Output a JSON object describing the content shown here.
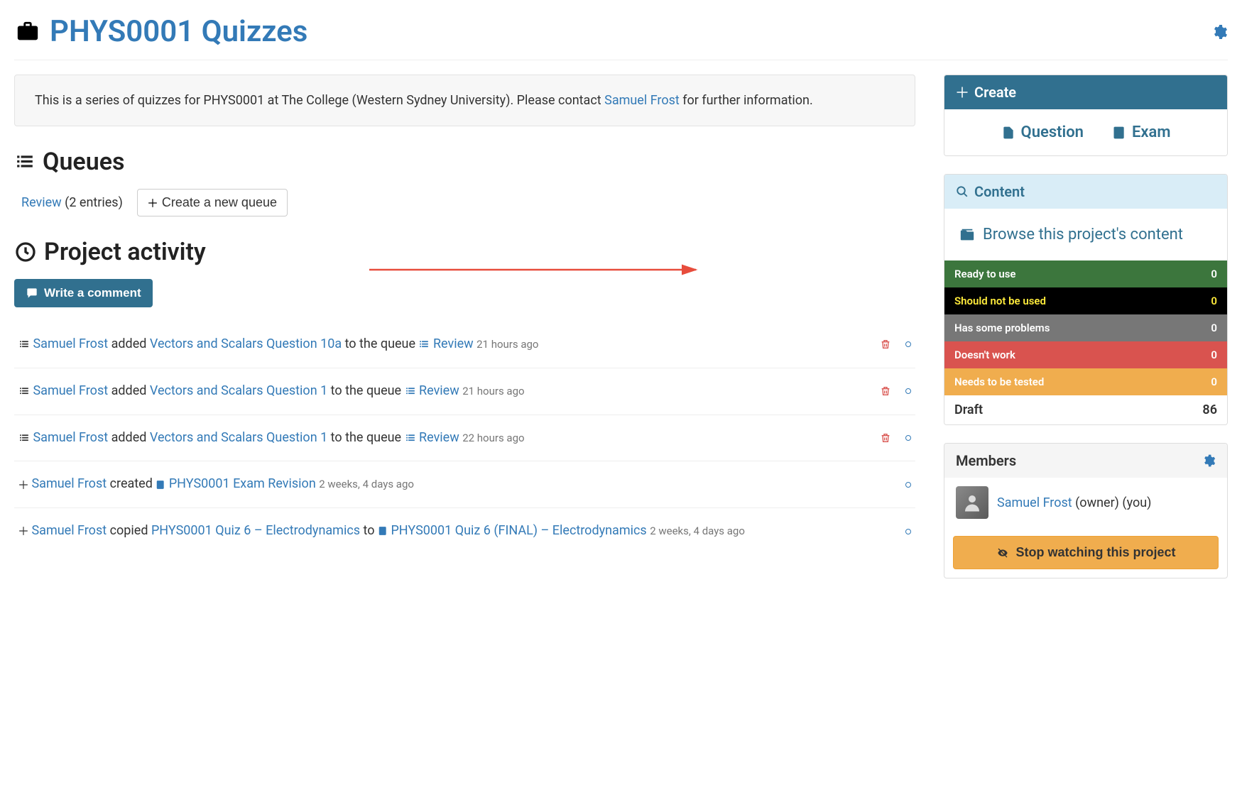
{
  "header": {
    "title": "PHYS0001 Quizzes"
  },
  "description": {
    "prefix": "This is a series of quizzes for PHYS0001 at The College (Western Sydney University). Please contact ",
    "contact_name": "Samuel Frost",
    "suffix": " for further information."
  },
  "queues": {
    "title": "Queues",
    "review_label": "Review",
    "entries": "(2 entries)",
    "create_button": "Create a new queue"
  },
  "activity": {
    "title": "Project activity",
    "write_comment": "Write a comment",
    "items": [
      {
        "user": "Samuel Frost",
        "verb": "added",
        "object": "Vectors and Scalars Question 10a",
        "middle": "to the queue",
        "target": "Review",
        "time": "21 hours ago",
        "icon": "list",
        "has_target_icon": true,
        "deletable": true
      },
      {
        "user": "Samuel Frost",
        "verb": "added",
        "object": "Vectors and Scalars Question 1",
        "middle": "to the queue",
        "target": "Review",
        "time": "21 hours ago",
        "icon": "list",
        "has_target_icon": true,
        "deletable": true
      },
      {
        "user": "Samuel Frost",
        "verb": "added",
        "object": "Vectors and Scalars Question 1",
        "middle": "to the queue",
        "target": "Review",
        "time": "22 hours ago",
        "icon": "list",
        "has_target_icon": true,
        "deletable": true
      },
      {
        "user": "Samuel Frost",
        "verb": "created",
        "object": "PHYS0001 Exam Revision",
        "middle": "",
        "target": "",
        "time": "2 weeks, 4 days ago",
        "icon": "plus",
        "object_icon": "book",
        "deletable": false
      },
      {
        "user": "Samuel Frost",
        "verb": "copied",
        "object": "PHYS0001 Quiz 6 – Electrodynamics",
        "middle": "to",
        "target": "PHYS0001 Quiz 6 (FINAL) – Electrodynamics",
        "time": "2 weeks, 4 days ago",
        "icon": "plus",
        "target_icon": "book",
        "deletable": false
      }
    ]
  },
  "sidebar": {
    "create_header": "Create",
    "create_question": "Question",
    "create_exam": "Exam",
    "content_header": "Content",
    "browse_label": "Browse this project's content",
    "statuses": [
      {
        "label": "Ready to use",
        "count": "0",
        "class": "status-green"
      },
      {
        "label": "Should not be used",
        "count": "0",
        "class": "status-black"
      },
      {
        "label": "Has some problems",
        "count": "0",
        "class": "status-gray"
      },
      {
        "label": "Doesn't work",
        "count": "0",
        "class": "status-red"
      },
      {
        "label": "Needs to be tested",
        "count": "0",
        "class": "status-yellow"
      },
      {
        "label": "Draft",
        "count": "86",
        "class": "status-white"
      }
    ],
    "members_header": "Members",
    "member_name": "Samuel Frost",
    "member_role": "(owner) (you)",
    "stop_watching": "Stop watching this project"
  }
}
